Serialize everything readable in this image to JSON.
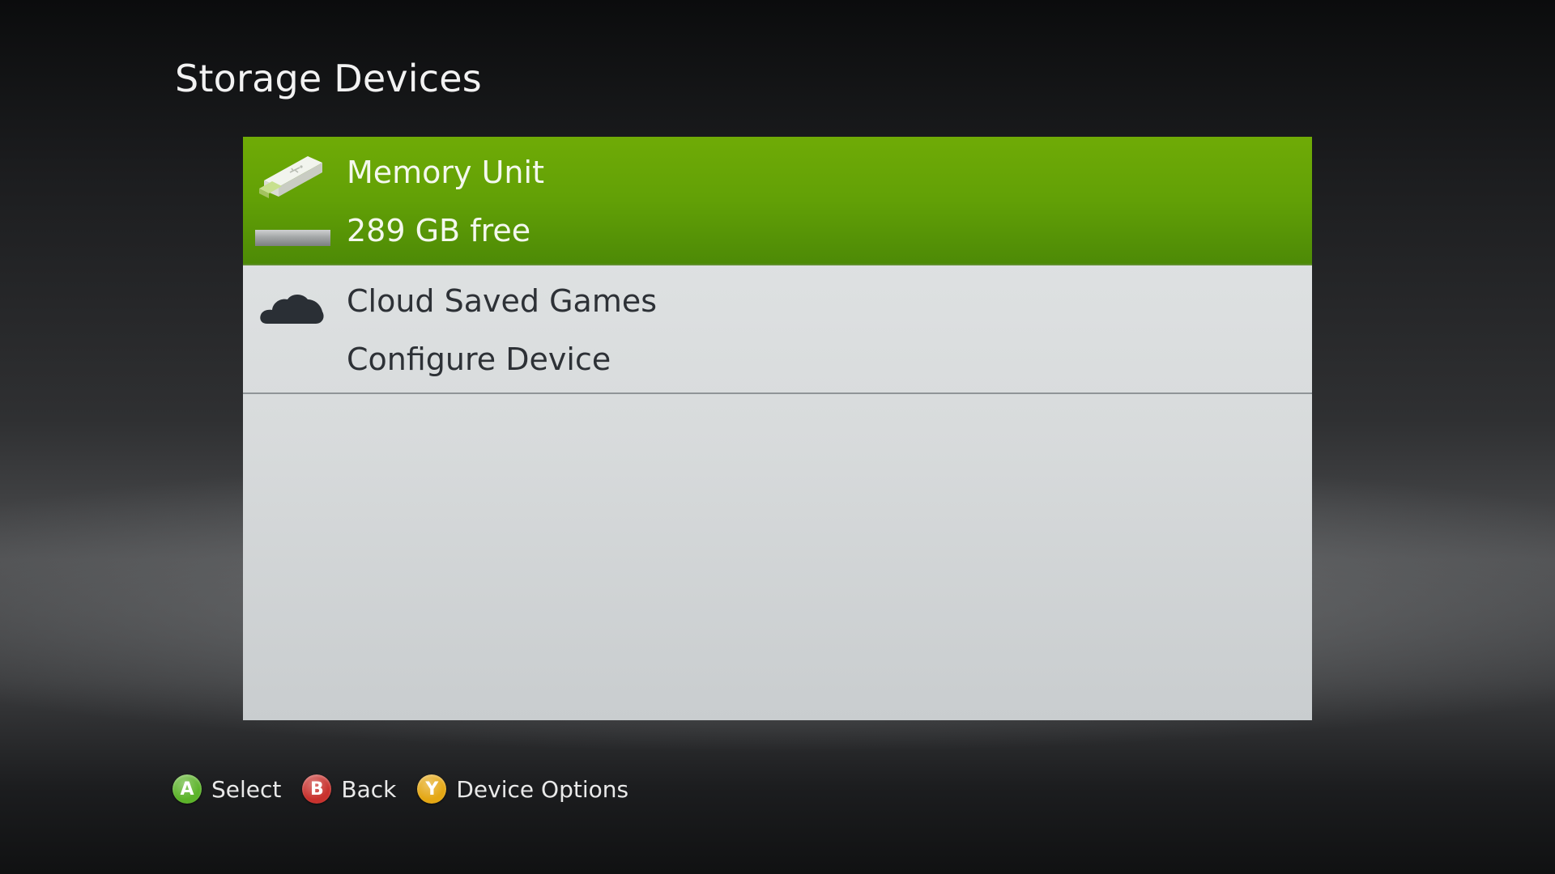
{
  "header": {
    "title": "Storage Devices"
  },
  "devices": [
    {
      "icon": "usb-drive-icon",
      "name": "Memory Unit",
      "detail": "289 GB free",
      "selected": true,
      "capacity_used_fraction": 0.0
    },
    {
      "icon": "cloud-icon",
      "name": "Cloud Saved Games",
      "detail": "Configure Device",
      "selected": false
    }
  ],
  "footer": {
    "hints": [
      {
        "button": "A",
        "label": "Select",
        "color": "#5cb32a"
      },
      {
        "button": "B",
        "label": "Back",
        "color": "#c8322e"
      },
      {
        "button": "Y",
        "label": "Device Options",
        "color": "#e4a714"
      }
    ]
  },
  "colors": {
    "selection_green": "#62a006",
    "panel_gray": "#d8dbdc",
    "text_dark": "#2d3136",
    "text_light": "#f4f8ee"
  }
}
